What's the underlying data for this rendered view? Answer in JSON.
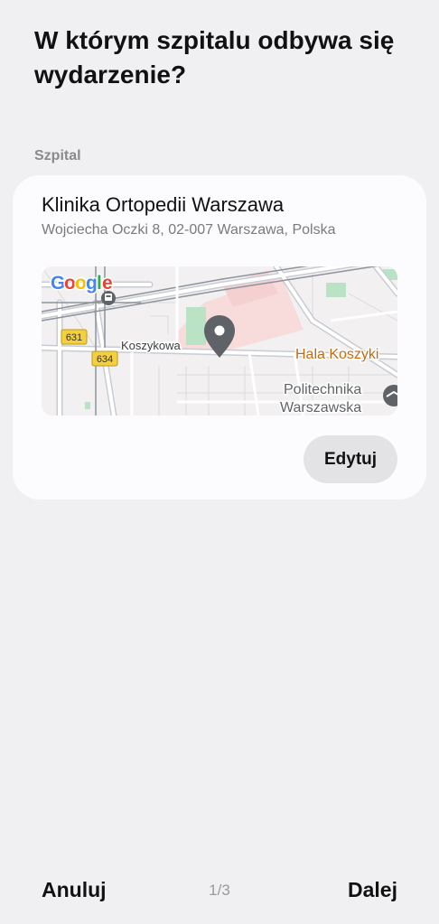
{
  "header": {
    "question": "W którym szpitalu odbywa się wydarzenie?"
  },
  "hospital_section": {
    "label": "Szpital",
    "name": "Klinika Ortopedii Warszawa",
    "address": "Wojciecha Oczki 8, 02-007 Warszawa, Polska",
    "edit_label": "Edytuj"
  },
  "map": {
    "provider_logo": "Google",
    "street_label": "Koszykowa",
    "road_badges": [
      "631",
      "634"
    ],
    "poi_orange": "Hala Koszyki",
    "poi_gray_line1": "Politechnika",
    "poi_gray_line2": "Warszawska",
    "pin_icon": "location-pin-icon",
    "colors": {
      "pin": "#5f6368",
      "poi_orange": "#c26a12",
      "road_badge": "#f4d03f",
      "park": "#b9e3c4"
    }
  },
  "footer": {
    "cancel_label": "Anuluj",
    "page_indicator": "1/3",
    "next_label": "Dalej"
  }
}
